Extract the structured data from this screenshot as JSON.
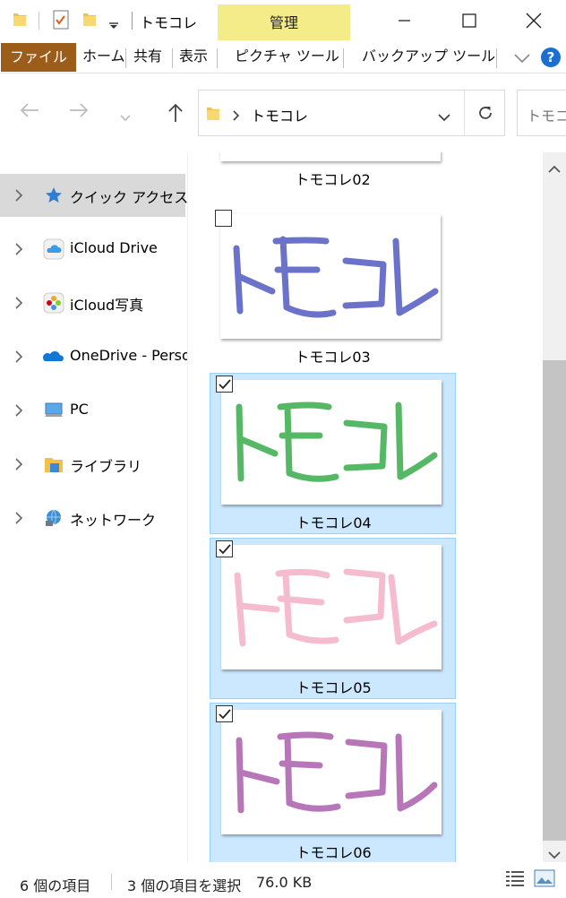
{
  "titlebar": {
    "title": "トモコレ",
    "manage_tab": "管理"
  },
  "ribbon": {
    "tabs": [
      "ファイル",
      "ホーム",
      "共有",
      "表示",
      "ピクチャ ツール",
      "バックアップ ツール"
    ],
    "help": "?"
  },
  "address": {
    "path": "トモコレ",
    "search_placeholder": "トモコレ"
  },
  "nav": {
    "items": [
      {
        "label": "クイック アクセス",
        "icon": "star-icon"
      },
      {
        "label": "iCloud Drive",
        "icon": "icloud-drive-icon"
      },
      {
        "label": "iCloud写真",
        "icon": "icloud-photos-icon"
      },
      {
        "label": "OneDrive - Perso",
        "icon": "onedrive-icon"
      },
      {
        "label": "PC",
        "icon": "pc-icon"
      },
      {
        "label": "ライブラリ",
        "icon": "library-icon"
      },
      {
        "label": "ネットワーク",
        "icon": "network-icon"
      }
    ]
  },
  "files": [
    {
      "name": "トモコレ02",
      "selected": false,
      "color": "#6a6ac8"
    },
    {
      "name": "トモコレ03",
      "selected": false,
      "color": "#6b72c9"
    },
    {
      "name": "トモコレ04",
      "selected": true,
      "color": "#55b865"
    },
    {
      "name": "トモコレ05",
      "selected": true,
      "color": "#f5bcd0"
    },
    {
      "name": "トモコレ06",
      "selected": true,
      "color": "#b676b8"
    }
  ],
  "status": {
    "item_count": "6 個の項目",
    "selection": "3 個の項目を選択",
    "size": "76.0 KB"
  },
  "colors": {
    "file_tab": "#9c5c1a",
    "manage_tab": "#f3ec88",
    "selection_bg": "#cce8ff",
    "selection_border": "#99d1ff"
  }
}
